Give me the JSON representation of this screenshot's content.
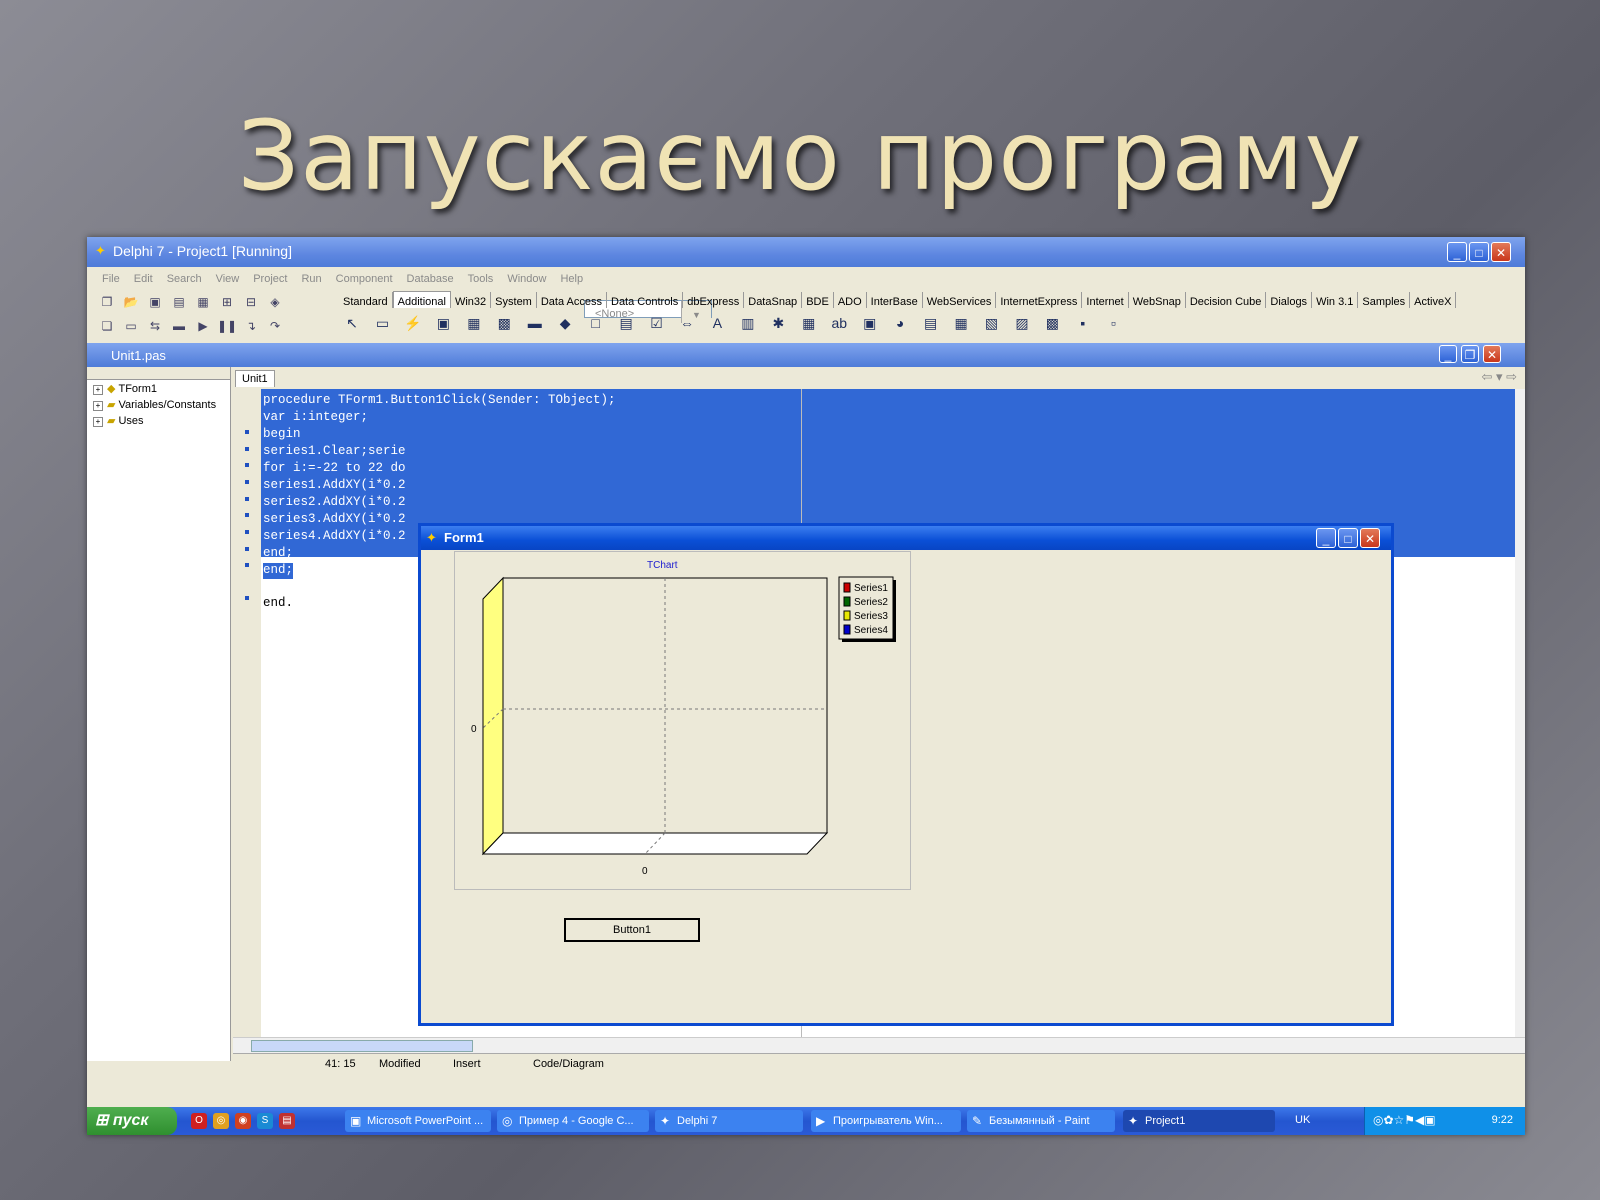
{
  "slide": {
    "title": "Запускаємо програму"
  },
  "window": {
    "title": "Delphi 7 - Project1 [Running]",
    "menu": [
      "File",
      "Edit",
      "Search",
      "View",
      "Project",
      "Run",
      "Component",
      "Database",
      "Tools",
      "Window",
      "Help"
    ],
    "combo_value": "<None>",
    "palette_tabs": [
      "Standard",
      "Additional",
      "Win32",
      "System",
      "Data Access",
      "Data Controls",
      "dbExpress",
      "DataSnap",
      "BDE",
      "ADO",
      "InterBase",
      "WebServices",
      "InternetExpress",
      "Internet",
      "WebSnap",
      "Decision Cube",
      "Dialogs",
      "Win 3.1",
      "Samples",
      "ActiveX"
    ],
    "palette_active": "Additional"
  },
  "editor": {
    "title": "Unit1.pas",
    "tree": [
      "TForm1",
      "Variables/Constants",
      "Uses"
    ],
    "tab": "Unit1",
    "code": [
      "procedure TForm1.Button1Click(Sender: TObject);",
      "var i:integer;",
      "begin",
      "series1.Clear;serie",
      "for i:=-22 to 22 do",
      "series1.AddXY(i*0.2",
      "series2.AddXY(i*0.2",
      "series3.AddXY(i*0.2",
      "series4.AddXY(i*0.2",
      "end;",
      "end;",
      "",
      "end."
    ],
    "status": {
      "position": "41: 15",
      "modified": "Modified",
      "mode": "Insert",
      "views": "Code/Diagram"
    }
  },
  "form1": {
    "title": "Form1",
    "button_label": "Button1"
  },
  "chart_data": {
    "type": "line",
    "title": "TChart",
    "x_tick": "0",
    "y_tick": "0",
    "series": [
      {
        "name": "Series1",
        "color": "#cc0000",
        "values": []
      },
      {
        "name": "Series2",
        "color": "#006600",
        "values": []
      },
      {
        "name": "Series3",
        "color": "#e8e800",
        "values": []
      },
      {
        "name": "Series4",
        "color": "#0000cc",
        "values": []
      }
    ],
    "legend": "right",
    "wall_color": "#ffff80"
  },
  "taskbar": {
    "start": "пуск",
    "tasks": [
      "Microsoft PowerPoint ...",
      "Пример 4 - Google C...",
      "Delphi 7",
      "Проигрыватель Win...",
      "Безымянный - Paint",
      "Project1"
    ],
    "active_task": "Project1",
    "lang": "UK",
    "clock": "9:22"
  }
}
